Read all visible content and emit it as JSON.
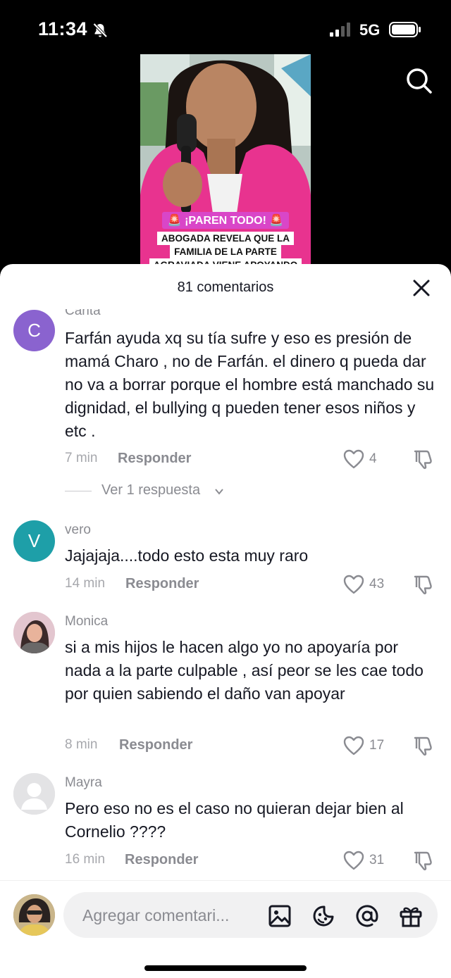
{
  "status": {
    "time": "11:34",
    "network": "5G"
  },
  "video": {
    "badge": "🚨 ¡PAREN TODO! 🚨",
    "lines": [
      "ABOGADA REVELA QUE LA",
      "FAMILIA DE LA PARTE",
      "AGRAVIADA VIENE APOYANDO"
    ]
  },
  "sheet": {
    "title": "81 comentarios"
  },
  "comments": [
    {
      "username": "Carita",
      "avatar_letter": "C",
      "avatar_color": "#8a63cf",
      "text": "Farfán ayuda xq su tía sufre y eso es presión de mamá Charo , no de Farfán. el dinero q pueda dar no va a borrar porque el hombre está manchado su dignidad, el bullying q pueden tener esos niños y etc .",
      "time": "7 min",
      "reply": "Responder",
      "likes": "4",
      "replies_label": "Ver 1 respuesta"
    },
    {
      "username": "vero",
      "avatar_letter": "V",
      "avatar_color": "#1e9fa8",
      "text": "Jajajaja....todo esto esta muy raro",
      "time": "14 min",
      "reply": "Responder",
      "likes": "43"
    },
    {
      "username": "Monica",
      "text": "si a mis hijos le hacen algo yo no apoyaría por nada a la parte culpable , así peor se les cae todo por quien sabiendo el daño van apoyar",
      "time": "8 min",
      "reply": "Responder",
      "likes": "17"
    },
    {
      "username": "Mayra",
      "text": "Pero eso no es el caso no quieran dejar bien al Cornelio ????",
      "time": "16 min",
      "reply": "Responder",
      "likes": "31"
    }
  ],
  "input": {
    "placeholder": "Agregar comentari..."
  },
  "colors": {
    "text": "#161823",
    "muted": "#8a8b91",
    "sheet_bg": "#ffffff"
  }
}
